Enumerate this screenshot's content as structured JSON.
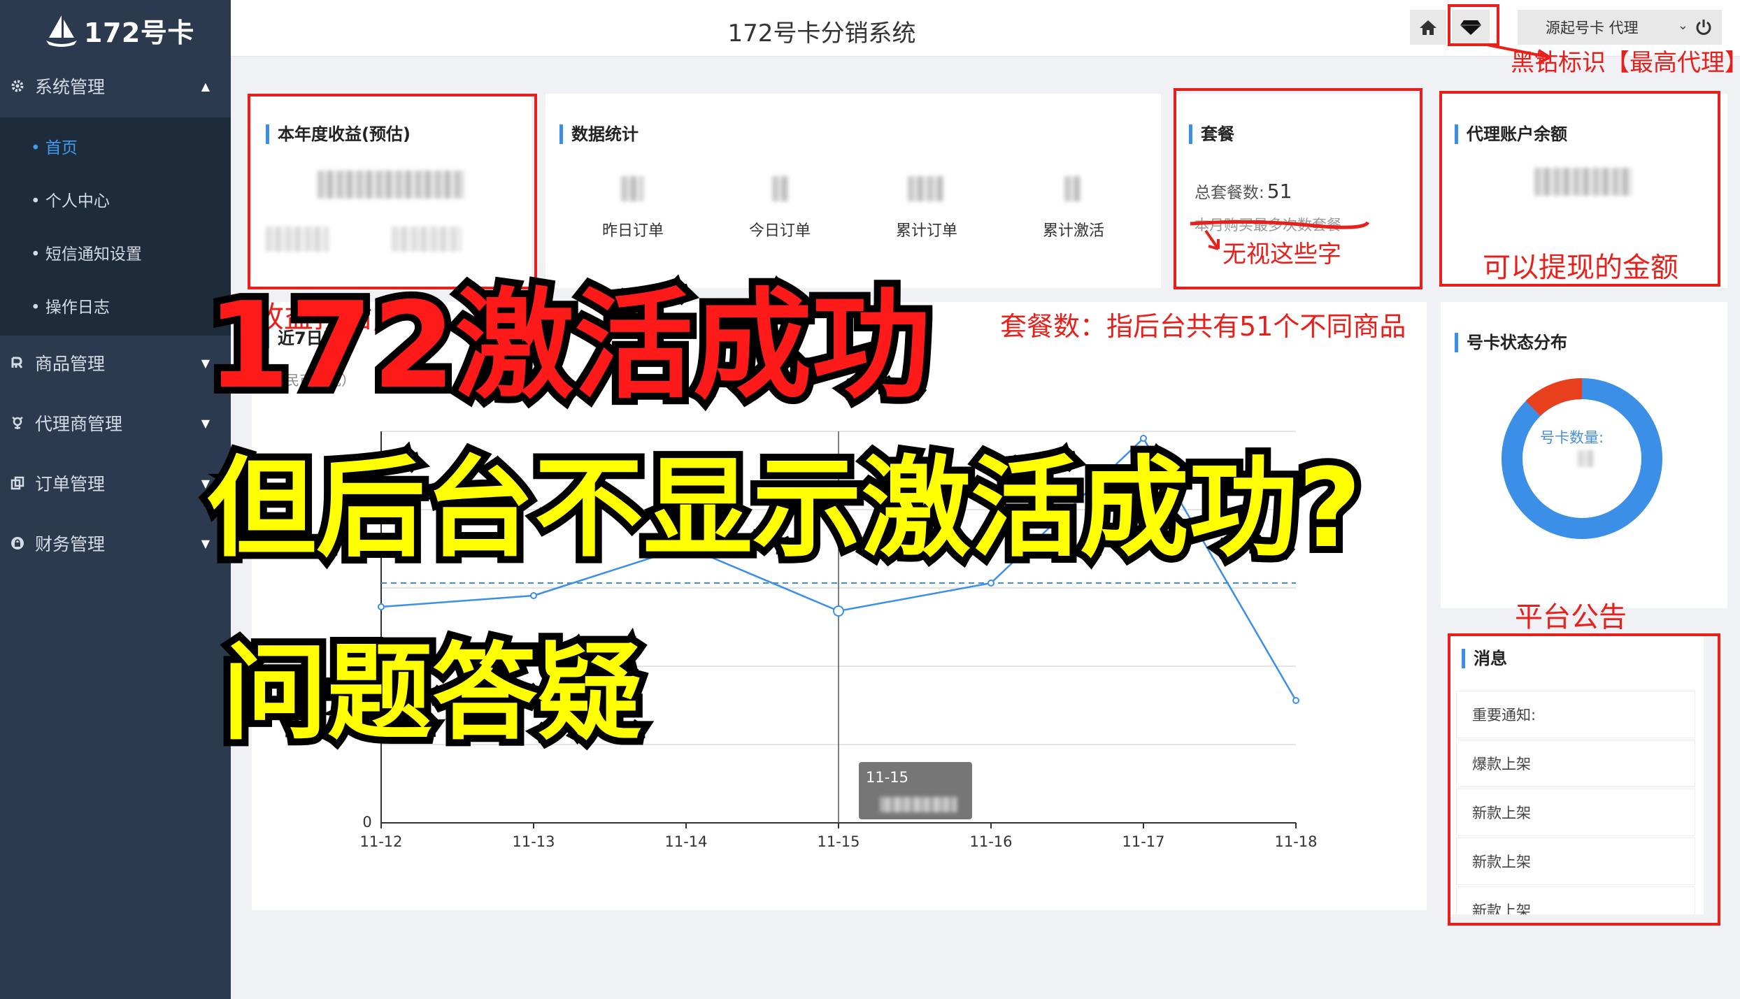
{
  "app": {
    "logo_text": "172号卡",
    "system_title": "172号卡分销系统"
  },
  "topbar": {
    "user_name": "源起号卡 代理",
    "diamond_note": "黑钻标识【最高代理】"
  },
  "sidebar": {
    "system": "系统管理",
    "sub_items": [
      "首页",
      "个人中心",
      "短信通知设置",
      "操作日志"
    ],
    "groups": [
      "商品管理",
      "代理商管理",
      "订单管理",
      "财务管理"
    ]
  },
  "cards": {
    "annual": {
      "title": "本年度收益(预估)"
    },
    "stats": {
      "title": "数据统计",
      "labels": [
        "昨日订单",
        "今日订单",
        "累计订单",
        "累计激活"
      ]
    },
    "package": {
      "title": "套餐",
      "total_label": "总套餐数:",
      "total_value": "51",
      "struck_text": "本月购买最多次数套餐"
    },
    "balance": {
      "title": "代理账户余额"
    },
    "chart": {
      "title": "近7日收益",
      "yunit": "人民币（元）"
    },
    "status": {
      "title": "号卡状态分布",
      "center_label": "号卡数量:"
    },
    "messages": {
      "title": "消息",
      "items": [
        "重要通知:",
        "爆款上架",
        "新款上架",
        "新款上架",
        "新款上架"
      ]
    }
  },
  "chart_data": {
    "type": "line",
    "x": [
      "11-12",
      "11-13",
      "11-14",
      "11-15",
      "11-16",
      "11-17",
      "11-18"
    ],
    "y_zero_label": "0",
    "tooltip_date": "11-15"
  },
  "annotations": {
    "ignore": "无视这些字",
    "withdraw": "可以提现的金额",
    "package_note": "套餐数：指后台共有51个不同商品",
    "platform": "平台公告",
    "revenue_partial": "收益预估,"
  },
  "captions": {
    "line1": "172激活成功",
    "line2": "但后台不显示激活成功?",
    "line3": "问题答疑"
  },
  "colors": {
    "sidebar": "#2b3a4e",
    "sidebar_sub": "#1e2b3b",
    "accent": "#3b8fe6",
    "annotation_red": "#e8201c",
    "caption_red": "#ff1a1a",
    "caption_yellow": "#ffff00"
  }
}
